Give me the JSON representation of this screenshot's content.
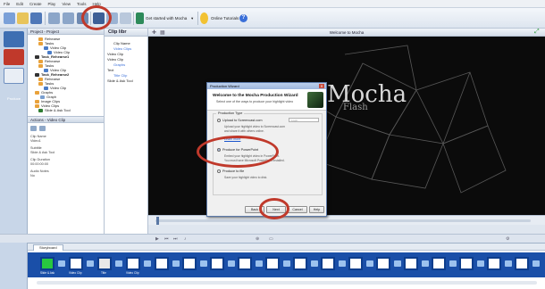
{
  "menubar": {
    "items": [
      "File",
      "Edit",
      "Create",
      "Play",
      "View",
      "Tools",
      "Help"
    ]
  },
  "toolbar": {
    "tutorial_dropdown": "Get started with Mocha",
    "online_tutorials": "Online Tutorials"
  },
  "rail": {
    "label": "Produce"
  },
  "project_tree": {
    "header": "Project - Project",
    "items": [
      "Rehearse",
      "Tasks",
      "Video Clip",
      "Video Clip",
      "Task_Rehearse1",
      "Rehearse",
      "Tasks",
      "Video Clip",
      "Task_Rehearse2",
      "Rehearse",
      "Tasks",
      "Video Clip",
      "Graphs",
      "Graph",
      "Image Clips",
      "Video Clips",
      "Slide & Ask Tool"
    ]
  },
  "properties": {
    "header": "Actions - Video Clip",
    "lines": [
      "Clip Name",
      "Video1",
      "Subtitle",
      "Slide & Ask Tool",
      "Clip Duration",
      "00:00:00:00",
      "Audio Notes",
      "No"
    ]
  },
  "clip_list": {
    "header": "Clip libr",
    "items": [
      "Clip Name",
      "Video Clips",
      "Video Clip",
      "Video Clip",
      "Graphs",
      "Text",
      "Title Clip",
      "Slide & Ask Tool"
    ]
  },
  "preview": {
    "title": "Welcome to Mocha",
    "brand": "Mocha",
    "brand_sub": "Flash"
  },
  "dialog": {
    "title": "Production Wizard",
    "heading": "Welcome to the Mocha Production Wizard",
    "subheading": "Select one of the ways to produce your highlight video",
    "group_label": "Production Type",
    "options": [
      {
        "label": "Upload to Screencast.com",
        "selected": false
      },
      {
        "label": "Produce for PowerPoint",
        "selected": true
      },
      {
        "label": "Produce to file",
        "selected": false
      }
    ],
    "field_placeholder": "Login",
    "descriptions": [
      "Upload your highlight video to Screencast.com",
      "and share it with others online.",
      "Embed your highlight video in PowerPoint.",
      "You must have Microsoft PowerPoint installed.",
      "Save your highlight video to disk."
    ],
    "link": "Learn more",
    "buttons": [
      "Back",
      "Next",
      "Cancel",
      "Help"
    ]
  },
  "storyboard": {
    "tab": "Storyboard",
    "captions": [
      "Slide & Ask",
      "Video Clip",
      "Title",
      "Video Clip"
    ]
  },
  "colors": {
    "annotation": "#c0392b",
    "storyboard": "#1a4fa8",
    "preview_bg": "#0b0b0b"
  }
}
